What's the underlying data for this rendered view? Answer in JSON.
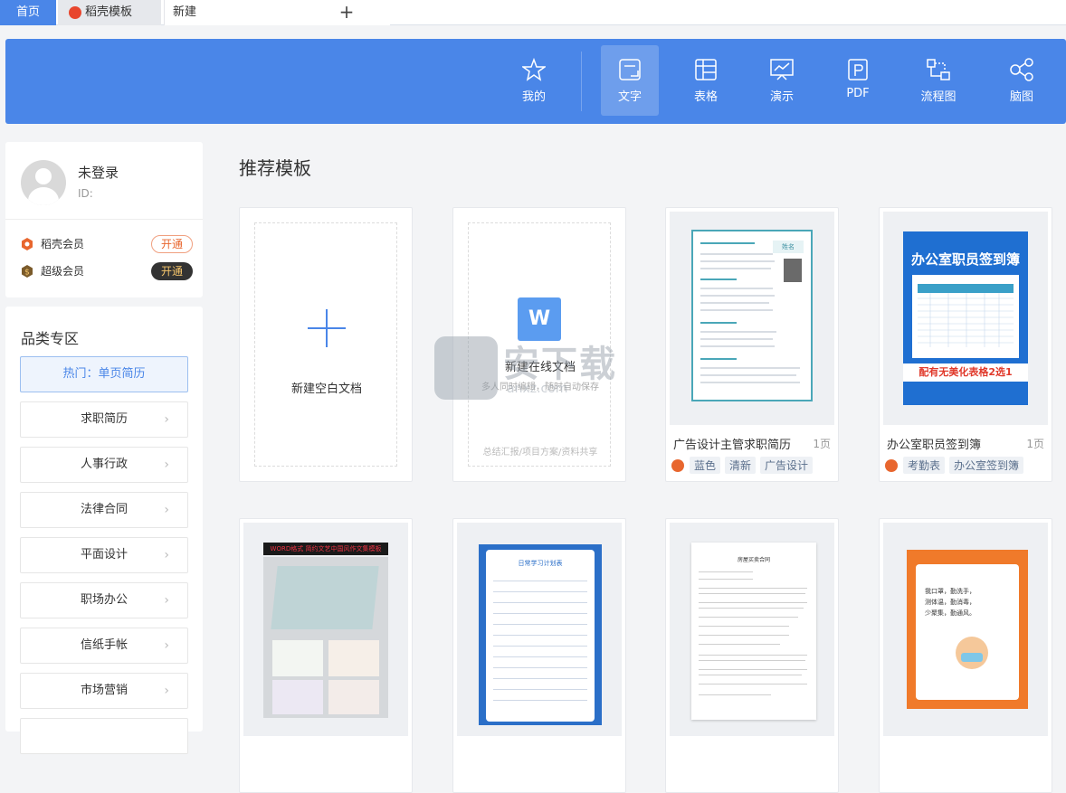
{
  "tabs": {
    "home": "首页",
    "docer": "稻壳模板",
    "new": "新建",
    "plus": "+"
  },
  "toolbar": {
    "items": [
      {
        "label": "我的",
        "icon": "star-icon"
      },
      {
        "label": "文字",
        "icon": "document-icon",
        "active": true
      },
      {
        "label": "表格",
        "icon": "table-icon"
      },
      {
        "label": "演示",
        "icon": "presentation-icon"
      },
      {
        "label": "PDF",
        "icon": "pdf-icon"
      },
      {
        "label": "流程图",
        "icon": "flowchart-icon"
      },
      {
        "label": "脑图",
        "icon": "mindmap-icon"
      }
    ]
  },
  "user": {
    "name": "未登录",
    "id_label": "ID:",
    "memberships": [
      {
        "label": "稻壳会员",
        "button": "开通",
        "color": "#e8662e"
      },
      {
        "label": "超级会员",
        "button": "开通",
        "color": "#8a6a3a"
      }
    ]
  },
  "categories": {
    "title": "品类专区",
    "hot": "热门：单页简历",
    "items": [
      "求职简历",
      "人事行政",
      "法律合同",
      "平面设计",
      "职场办公",
      "信纸手帐",
      "市场营销"
    ]
  },
  "main": {
    "section_title": "推荐模板",
    "new_blank": "新建空白文档",
    "new_online": {
      "icon_letter": "W",
      "label": "新建在线文档",
      "sub": "多人同时编辑，随时自动保存",
      "footer": "总结汇报/项目方案/资料共享"
    },
    "templates": [
      {
        "name": "广告设计主管求职简历",
        "pages": "1页",
        "tags": [
          "蓝色",
          "清新",
          "广告设计"
        ]
      },
      {
        "name": "办公室职员签到簿",
        "pages": "1页",
        "tags": [
          "考勤表",
          "办公室签到簿"
        ]
      }
    ],
    "signin_thumb": {
      "title": "办公室职员签到簿",
      "subtitle": "配有无美化表格2选1"
    },
    "resume_thumb": {
      "name": "姓名"
    },
    "study_thumb": {
      "title": "日常学习计划表"
    },
    "contract_thumb": {
      "title": "房屋买卖合同"
    },
    "book_thumb": {
      "banner": "WORD格式 简约文艺中国风作文集模板"
    },
    "poster_thumb": {
      "line1": "我口罩，勤洗手，",
      "line2": "测体温，勤消毒，",
      "line3": "少聚集，勤通风。"
    }
  },
  "watermark": {
    "text": "安下载",
    "url": "anxz.com"
  },
  "colors": {
    "accent": "#4a86e8",
    "orange": "#e8662e"
  }
}
